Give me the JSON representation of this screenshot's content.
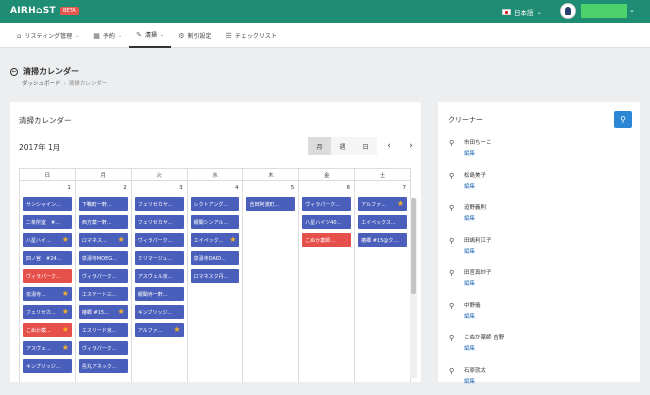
{
  "header": {
    "logo": "AIRH⌂ST",
    "beta": "BETA",
    "language": "日本語",
    "colors": {
      "bar": "#1f8d73",
      "beta": "#e8584f"
    }
  },
  "nav": [
    {
      "icon": "home-icon",
      "label": "リスティング管理",
      "caret": true
    },
    {
      "icon": "calendar-icon",
      "label": "予約",
      "caret": true
    },
    {
      "icon": "edit-icon",
      "label": "清掃",
      "caret": true,
      "active": true
    },
    {
      "icon": "gear-icon",
      "label": "割引設定",
      "caret": false
    },
    {
      "icon": "checklist-icon",
      "label": "チェックリスト",
      "caret": false
    }
  ],
  "page": {
    "title": "清掃カレンダー",
    "breadcrumb": [
      "ダッシュボード",
      "清掃カレンダー"
    ]
  },
  "calendar": {
    "heading": "清掃カレンダー",
    "month": "2017年 1月",
    "views": [
      "月",
      "週",
      "日"
    ],
    "selected_view": "月",
    "prev": "‹",
    "next": "›",
    "weekdays": [
      "日",
      "月",
      "火",
      "水",
      "木",
      "金",
      "土"
    ],
    "days": [
      {
        "num": "1",
        "events": [
          {
            "label": "サンシャイン...",
            "star": false,
            "color": "blue"
          },
          {
            "label": "二条所室　#...",
            "star": false,
            "color": "blue"
          },
          {
            "label": "八星ハイ...",
            "star": true,
            "color": "blue"
          },
          {
            "label": "四ノ宮　#24...",
            "star": false,
            "color": "blue"
          },
          {
            "label": "ヴィラパーク...",
            "star": false,
            "color": "red"
          },
          {
            "label": "泉湯寺...",
            "star": true,
            "color": "blue"
          },
          {
            "label": "フェリセカ...",
            "star": true,
            "color": "blue"
          },
          {
            "label": "こぬか薬...",
            "star": true,
            "color": "red"
          },
          {
            "label": "アスヴェ...",
            "star": true,
            "color": "blue"
          },
          {
            "label": "キンプリッジ...",
            "star": false,
            "color": "blue"
          }
        ]
      },
      {
        "num": "2",
        "events": [
          {
            "label": "下鴨町一軒...",
            "star": false,
            "color": "blue"
          },
          {
            "label": "西方薬一軒...",
            "star": false,
            "color": "blue"
          },
          {
            "label": "ロマネス...",
            "star": true,
            "color": "blue"
          },
          {
            "label": "泉湯寺MOEG...",
            "star": false,
            "color": "blue"
          },
          {
            "label": "ヴィラパーク...",
            "star": false,
            "color": "blue"
          },
          {
            "label": "エステート三...",
            "star": false,
            "color": "blue"
          },
          {
            "label": "椿郷 #15...",
            "star": true,
            "color": "blue"
          },
          {
            "label": "エスリード京...",
            "star": false,
            "color": "blue"
          },
          {
            "label": "ヴィラパーク...",
            "star": false,
            "color": "blue"
          },
          {
            "label": "島丸アネック...",
            "star": false,
            "color": "blue"
          }
        ]
      },
      {
        "num": "3",
        "events": [
          {
            "label": "フェリセカサ...",
            "star": false,
            "color": "blue"
          },
          {
            "label": "フェリセカサ...",
            "star": false,
            "color": "blue"
          },
          {
            "label": "ヴィラパーク...",
            "star": false,
            "color": "blue"
          },
          {
            "label": "ミリマージュ...",
            "star": false,
            "color": "blue"
          },
          {
            "label": "アスヴェル京...",
            "star": false,
            "color": "blue"
          },
          {
            "label": "銀閣寺一軒...",
            "star": false,
            "color": "blue"
          },
          {
            "label": "キンブリッジ...",
            "star": false,
            "color": "blue"
          },
          {
            "label": "アルファ...",
            "star": true,
            "color": "blue"
          }
        ]
      },
      {
        "num": "4",
        "events": [
          {
            "label": "レクトアング...",
            "star": false,
            "color": "blue"
          },
          {
            "label": "銀閣シンアル...",
            "star": false,
            "color": "blue"
          },
          {
            "label": "エイペック...",
            "star": true,
            "color": "blue"
          },
          {
            "label": "泉湯寺DAID...",
            "star": false,
            "color": "blue"
          },
          {
            "label": "ロマネスク丹...",
            "star": false,
            "color": "blue"
          }
        ]
      },
      {
        "num": "5",
        "events": [
          {
            "label": "吉田阿波町...",
            "star": false,
            "color": "blue"
          }
        ]
      },
      {
        "num": "6",
        "events": [
          {
            "label": "ヴィラパーク...",
            "star": false,
            "color": "blue"
          },
          {
            "label": "八星ハイツ40...",
            "star": false,
            "color": "blue"
          },
          {
            "label": "こぬか薬師...",
            "star": false,
            "color": "red"
          }
        ]
      },
      {
        "num": "7",
        "events": [
          {
            "label": "アルファ...",
            "star": true,
            "color": "blue"
          },
          {
            "label": "エイペックス...",
            "star": false,
            "color": "blue"
          },
          {
            "label": "椿郷 #15@ク...",
            "star": false,
            "color": "blue"
          }
        ]
      }
    ],
    "colors": {
      "event": "#4a5fbb",
      "event_alert": "#e5504a",
      "star": "#f5b225"
    }
  },
  "cleaners": {
    "title": "クリーナー",
    "add_button_icon": "add-user-icon",
    "edit_label": "編集",
    "list": [
      "市田ちーこ",
      "松島美子",
      "迫野義則",
      "田嶋利江子",
      "田宮真紗子",
      "中野儀",
      "こぬか薬師 吉野",
      "石原就太"
    ]
  }
}
